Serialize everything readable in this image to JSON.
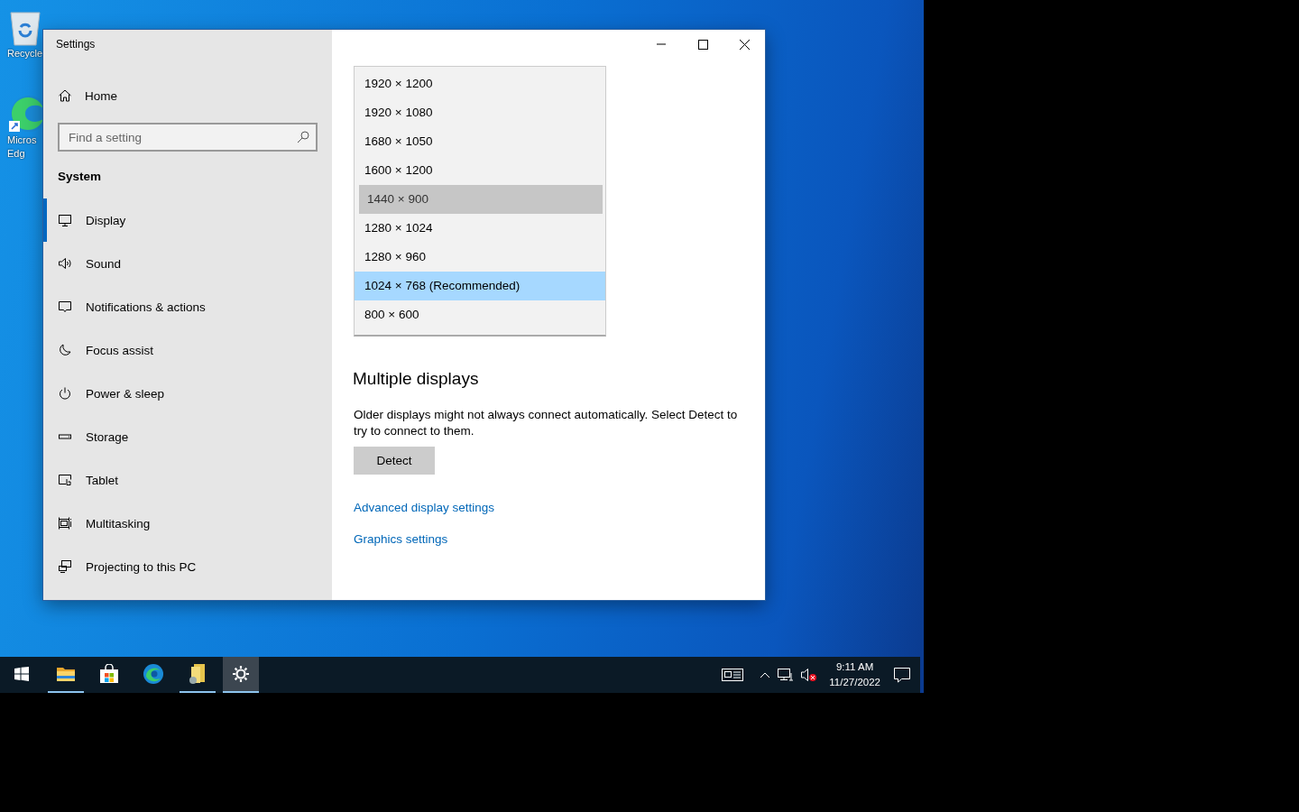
{
  "desktop": {
    "icons": [
      {
        "kind": "recycle-bin",
        "lines": [
          "Recycle"
        ]
      },
      {
        "kind": "edge",
        "lines": [
          "Micros",
          "Edg"
        ]
      }
    ]
  },
  "window": {
    "title": "Settings",
    "sidebar": {
      "home": "Home",
      "search": {
        "placeholder": "Find a setting"
      },
      "section": "System",
      "items": [
        {
          "kind": "display",
          "label": "Display",
          "selected": true
        },
        {
          "kind": "sound",
          "label": "Sound",
          "selected": false
        },
        {
          "kind": "notifications",
          "label": "Notifications & actions",
          "selected": false
        },
        {
          "kind": "focus",
          "label": "Focus assist",
          "selected": false
        },
        {
          "kind": "power",
          "label": "Power & sleep",
          "selected": false
        },
        {
          "kind": "storage",
          "label": "Storage",
          "selected": false
        },
        {
          "kind": "tablet",
          "label": "Tablet",
          "selected": false
        },
        {
          "kind": "multitasking",
          "label": "Multitasking",
          "selected": false
        },
        {
          "kind": "projecting",
          "label": "Projecting to this PC",
          "selected": false
        }
      ]
    },
    "resolution_list": {
      "items": [
        {
          "label": "1920 × 1200",
          "selected": false,
          "hovered": false
        },
        {
          "label": "1920 × 1080",
          "selected": false,
          "hovered": false
        },
        {
          "label": "1680 × 1050",
          "selected": false,
          "hovered": false
        },
        {
          "label": "1600 × 1200",
          "selected": false,
          "hovered": false
        },
        {
          "label": "1440 × 900",
          "selected": false,
          "hovered": true
        },
        {
          "label": "1280 × 1024",
          "selected": false,
          "hovered": false
        },
        {
          "label": "1280 × 960",
          "selected": false,
          "hovered": false
        },
        {
          "label": "1024 × 768 (Recommended)",
          "selected": true,
          "hovered": false
        },
        {
          "label": "800 × 600",
          "selected": false,
          "hovered": false
        }
      ]
    },
    "multiple_displays": {
      "heading": "Multiple displays",
      "text": "Older displays might not always connect automatically. Select Detect to try to connect to them.",
      "button": "Detect"
    },
    "links": [
      "Advanced display settings",
      "Graphics settings"
    ]
  },
  "taskbar": {
    "apps": [
      {
        "kind": "start",
        "running": false,
        "selected": false
      },
      {
        "kind": "explorer",
        "running": true,
        "selected": false
      },
      {
        "kind": "store",
        "running": false,
        "selected": false
      },
      {
        "kind": "edge",
        "running": false,
        "selected": false
      },
      {
        "kind": "app",
        "running": true,
        "selected": false
      },
      {
        "kind": "settings",
        "running": true,
        "selected": true
      }
    ],
    "time": "9:11 AM",
    "date": "11/27/2022"
  }
}
